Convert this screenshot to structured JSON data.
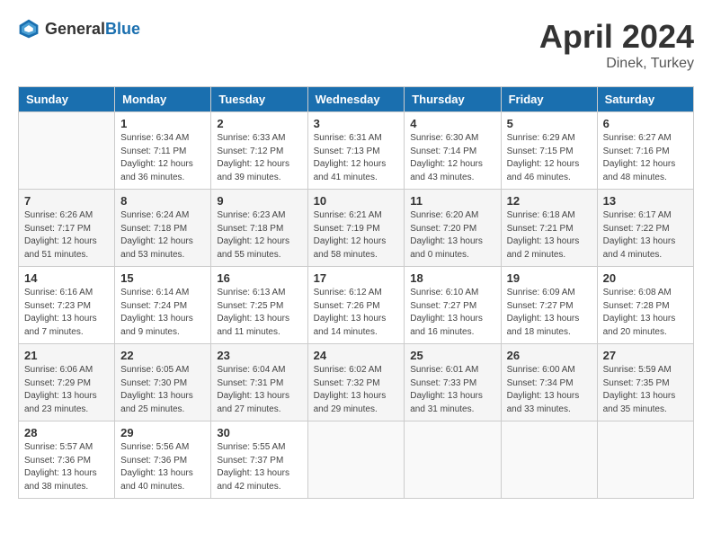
{
  "header": {
    "logo_general": "General",
    "logo_blue": "Blue",
    "month": "April 2024",
    "location": "Dinek, Turkey"
  },
  "weekdays": [
    "Sunday",
    "Monday",
    "Tuesday",
    "Wednesday",
    "Thursday",
    "Friday",
    "Saturday"
  ],
  "weeks": [
    [
      {
        "day": "",
        "info": ""
      },
      {
        "day": "1",
        "info": "Sunrise: 6:34 AM\nSunset: 7:11 PM\nDaylight: 12 hours\nand 36 minutes."
      },
      {
        "day": "2",
        "info": "Sunrise: 6:33 AM\nSunset: 7:12 PM\nDaylight: 12 hours\nand 39 minutes."
      },
      {
        "day": "3",
        "info": "Sunrise: 6:31 AM\nSunset: 7:13 PM\nDaylight: 12 hours\nand 41 minutes."
      },
      {
        "day": "4",
        "info": "Sunrise: 6:30 AM\nSunset: 7:14 PM\nDaylight: 12 hours\nand 43 minutes."
      },
      {
        "day": "5",
        "info": "Sunrise: 6:29 AM\nSunset: 7:15 PM\nDaylight: 12 hours\nand 46 minutes."
      },
      {
        "day": "6",
        "info": "Sunrise: 6:27 AM\nSunset: 7:16 PM\nDaylight: 12 hours\nand 48 minutes."
      }
    ],
    [
      {
        "day": "7",
        "info": "Sunrise: 6:26 AM\nSunset: 7:17 PM\nDaylight: 12 hours\nand 51 minutes."
      },
      {
        "day": "8",
        "info": "Sunrise: 6:24 AM\nSunset: 7:18 PM\nDaylight: 12 hours\nand 53 minutes."
      },
      {
        "day": "9",
        "info": "Sunrise: 6:23 AM\nSunset: 7:18 PM\nDaylight: 12 hours\nand 55 minutes."
      },
      {
        "day": "10",
        "info": "Sunrise: 6:21 AM\nSunset: 7:19 PM\nDaylight: 12 hours\nand 58 minutes."
      },
      {
        "day": "11",
        "info": "Sunrise: 6:20 AM\nSunset: 7:20 PM\nDaylight: 13 hours\nand 0 minutes."
      },
      {
        "day": "12",
        "info": "Sunrise: 6:18 AM\nSunset: 7:21 PM\nDaylight: 13 hours\nand 2 minutes."
      },
      {
        "day": "13",
        "info": "Sunrise: 6:17 AM\nSunset: 7:22 PM\nDaylight: 13 hours\nand 4 minutes."
      }
    ],
    [
      {
        "day": "14",
        "info": "Sunrise: 6:16 AM\nSunset: 7:23 PM\nDaylight: 13 hours\nand 7 minutes."
      },
      {
        "day": "15",
        "info": "Sunrise: 6:14 AM\nSunset: 7:24 PM\nDaylight: 13 hours\nand 9 minutes."
      },
      {
        "day": "16",
        "info": "Sunrise: 6:13 AM\nSunset: 7:25 PM\nDaylight: 13 hours\nand 11 minutes."
      },
      {
        "day": "17",
        "info": "Sunrise: 6:12 AM\nSunset: 7:26 PM\nDaylight: 13 hours\nand 14 minutes."
      },
      {
        "day": "18",
        "info": "Sunrise: 6:10 AM\nSunset: 7:27 PM\nDaylight: 13 hours\nand 16 minutes."
      },
      {
        "day": "19",
        "info": "Sunrise: 6:09 AM\nSunset: 7:27 PM\nDaylight: 13 hours\nand 18 minutes."
      },
      {
        "day": "20",
        "info": "Sunrise: 6:08 AM\nSunset: 7:28 PM\nDaylight: 13 hours\nand 20 minutes."
      }
    ],
    [
      {
        "day": "21",
        "info": "Sunrise: 6:06 AM\nSunset: 7:29 PM\nDaylight: 13 hours\nand 23 minutes."
      },
      {
        "day": "22",
        "info": "Sunrise: 6:05 AM\nSunset: 7:30 PM\nDaylight: 13 hours\nand 25 minutes."
      },
      {
        "day": "23",
        "info": "Sunrise: 6:04 AM\nSunset: 7:31 PM\nDaylight: 13 hours\nand 27 minutes."
      },
      {
        "day": "24",
        "info": "Sunrise: 6:02 AM\nSunset: 7:32 PM\nDaylight: 13 hours\nand 29 minutes."
      },
      {
        "day": "25",
        "info": "Sunrise: 6:01 AM\nSunset: 7:33 PM\nDaylight: 13 hours\nand 31 minutes."
      },
      {
        "day": "26",
        "info": "Sunrise: 6:00 AM\nSunset: 7:34 PM\nDaylight: 13 hours\nand 33 minutes."
      },
      {
        "day": "27",
        "info": "Sunrise: 5:59 AM\nSunset: 7:35 PM\nDaylight: 13 hours\nand 35 minutes."
      }
    ],
    [
      {
        "day": "28",
        "info": "Sunrise: 5:57 AM\nSunset: 7:36 PM\nDaylight: 13 hours\nand 38 minutes."
      },
      {
        "day": "29",
        "info": "Sunrise: 5:56 AM\nSunset: 7:36 PM\nDaylight: 13 hours\nand 40 minutes."
      },
      {
        "day": "30",
        "info": "Sunrise: 5:55 AM\nSunset: 7:37 PM\nDaylight: 13 hours\nand 42 minutes."
      },
      {
        "day": "",
        "info": ""
      },
      {
        "day": "",
        "info": ""
      },
      {
        "day": "",
        "info": ""
      },
      {
        "day": "",
        "info": ""
      }
    ]
  ]
}
